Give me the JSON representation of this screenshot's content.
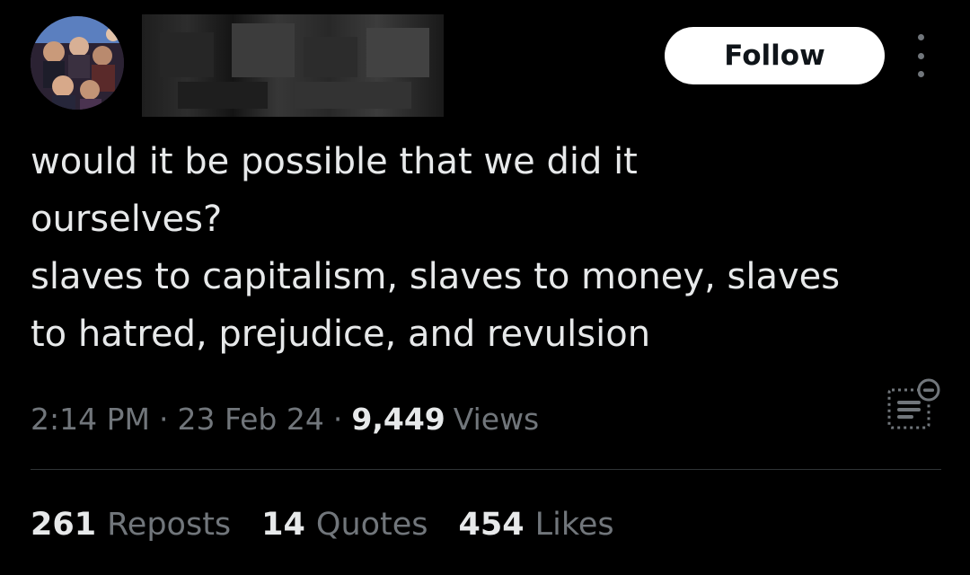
{
  "colors": {
    "background": "#000000",
    "text_primary": "#e7e9ea",
    "text_secondary": "#71767b",
    "divider": "#2f3336",
    "follow_button_bg": "#ffffff",
    "follow_button_text": "#0f1419"
  },
  "header": {
    "avatar_icon": "group-photo-avatar",
    "display_name": "",
    "follow_label": "Follow",
    "more_icon": "more-vertical-icon"
  },
  "tweet": {
    "text": "would it be possible that we did it\nourselves?\nslaves to capitalism, slaves to money, slaves\nto hatred, prejudice, and revulsion"
  },
  "meta": {
    "time": "2:14 PM",
    "date": "23 Feb 24",
    "separator": "·",
    "views_count": "9,449",
    "views_label": "Views",
    "analytics_icon": "analytics-icon"
  },
  "stats": [
    {
      "count": "261",
      "label": "Reposts"
    },
    {
      "count": "14",
      "label": "Quotes"
    },
    {
      "count": "454",
      "label": "Likes"
    }
  ]
}
